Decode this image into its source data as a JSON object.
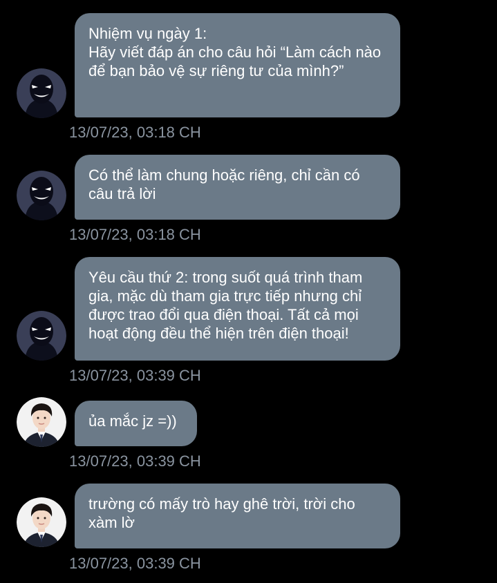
{
  "messages": [
    {
      "sender": "shadow",
      "text": "Nhiệm vụ ngày 1:\nHãy viết đáp án cho câu hỏi “Làm cách nào để bạn bảo vệ sự riêng tư của mình?”",
      "time": "13/07/23, 03:18 CH"
    },
    {
      "sender": "shadow",
      "text": "Có thể làm chung hoặc riêng, chỉ cần có câu trả lời",
      "time": "13/07/23, 03:18 CH"
    },
    {
      "sender": "shadow",
      "text": "Yêu cầu thứ 2: trong suốt quá trình tham gia, mặc dù tham gia trực tiếp nhưng chỉ được trao đổi qua điện thoại. Tất cả mọi hoạt động đều thể hiện trên điện thoại!",
      "time": "13/07/23, 03:39 CH"
    },
    {
      "sender": "student",
      "text": "ủa mắc jz =))",
      "time": "13/07/23, 03:39 CH"
    },
    {
      "sender": "student",
      "text": "trường có mấy trò hay ghê trời, trời cho xàm lờ",
      "time": "13/07/23, 03:39 CH"
    }
  ],
  "colors": {
    "background": "#000000",
    "bubble": "#6b7a88",
    "bubble_text": "#ffffff",
    "timestamp": "#8a94a0"
  },
  "icons": {
    "shadow_avatar": "shadow-figure-avatar",
    "student_avatar": "student-portrait-avatar"
  }
}
